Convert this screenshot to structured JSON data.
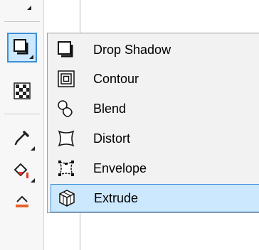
{
  "toolbox": {
    "tools": [
      {
        "icon": "drop-shadow-tool-icon",
        "active": true
      },
      {
        "icon": "transparency-tool-icon"
      },
      {
        "icon": "eyedropper-tool-icon"
      },
      {
        "icon": "interactive-fill-tool-icon"
      },
      {
        "icon": "smart-fill-tool-icon"
      }
    ]
  },
  "flyout": {
    "items": [
      {
        "label": "Drop Shadow",
        "icon": "drop-shadow-icon"
      },
      {
        "label": "Contour",
        "icon": "contour-icon"
      },
      {
        "label": "Blend",
        "icon": "blend-icon"
      },
      {
        "label": "Distort",
        "icon": "distort-icon"
      },
      {
        "label": "Envelope",
        "icon": "envelope-icon"
      },
      {
        "label": "Extrude",
        "icon": "extrude-icon",
        "highlighted": true
      }
    ]
  },
  "colors": {
    "highlight_bg": "#cce8ff",
    "highlight_border": "#3c8fd8",
    "fill_red": "#e23b2e"
  }
}
